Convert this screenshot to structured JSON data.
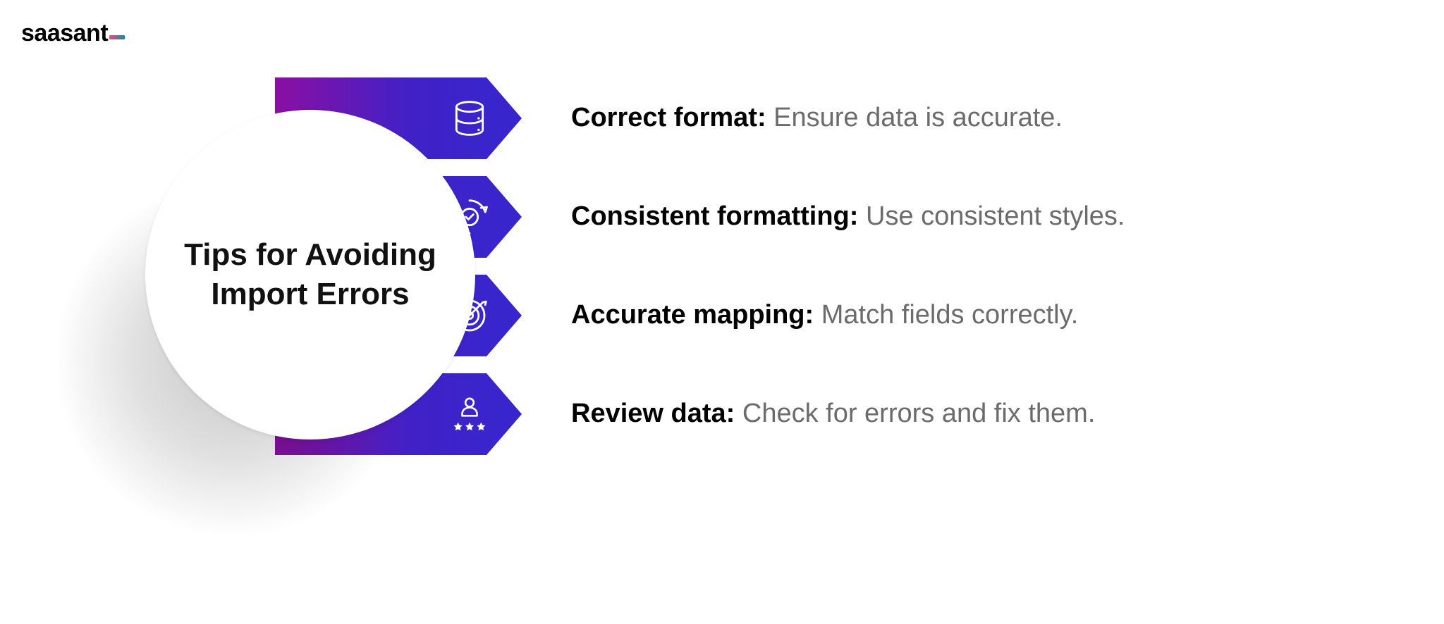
{
  "brand": {
    "name": "saasant"
  },
  "center": {
    "title_line1": "Tips for Avoiding",
    "title_line2": "Import Errors"
  },
  "colors": {
    "gradient_start": "#8a0fa3",
    "gradient_mid": "#4021c7",
    "gradient_end": "#3726cd",
    "text_primary": "#000000",
    "text_secondary": "#6b6b6b"
  },
  "items": [
    {
      "icon": "database-icon",
      "title": "Correct format",
      "title_suffix": ":",
      "desc": " Ensure data is accurate."
    },
    {
      "icon": "cycle-check-icon",
      "title": "Consistent formatting",
      "title_suffix": ":",
      "desc": " Use consistent styles."
    },
    {
      "icon": "target-icon",
      "title": "Accurate mapping",
      "title_suffix": ":",
      "desc": " Match fields correctly."
    },
    {
      "icon": "review-icon",
      "title": "Review data",
      "title_suffix": ":",
      "desc": " Check for errors and fix them."
    }
  ]
}
